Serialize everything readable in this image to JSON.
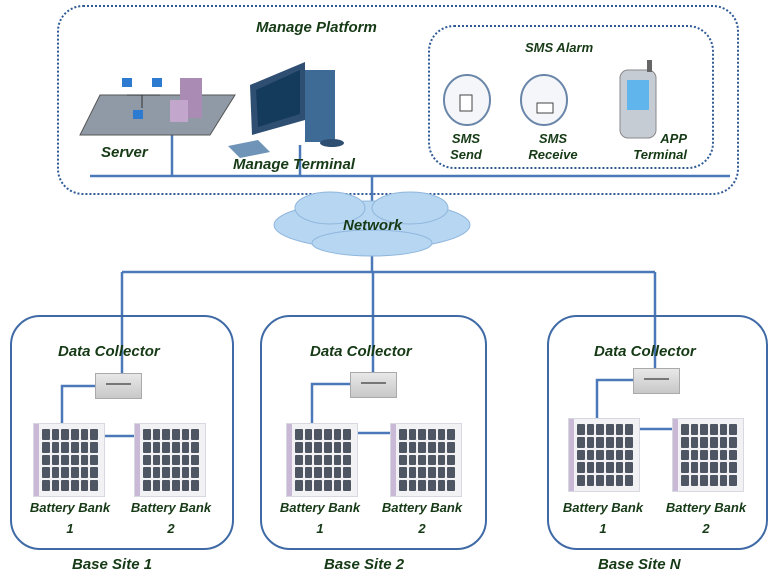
{
  "platform": {
    "title": "Manage Platform",
    "server": "Server",
    "terminal": "Manage Terminal"
  },
  "sms": {
    "title": "SMS Alarm",
    "send": [
      "SMS",
      "Send"
    ],
    "receive": [
      "SMS",
      "Receive"
    ],
    "app": [
      "APP",
      "Terminal"
    ]
  },
  "network": "Network",
  "sites": [
    {
      "name": "Base Site  1",
      "collector": "Data Collector",
      "banks": [
        {
          "label": "Battery Bank",
          "num": "1"
        },
        {
          "label": "Battery Bank",
          "num": "2"
        }
      ]
    },
    {
      "name": "Base Site  2",
      "collector": "Data Collector",
      "banks": [
        {
          "label": "Battery Bank",
          "num": "1"
        },
        {
          "label": "Battery Bank",
          "num": "2"
        }
      ]
    },
    {
      "name": "Base Site  N",
      "collector": "Data Collector",
      "banks": [
        {
          "label": "Battery Bank",
          "num": "1"
        },
        {
          "label": "Battery Bank",
          "num": "2"
        }
      ]
    }
  ],
  "colors": {
    "line": "#4a78b8",
    "text": "#163a16",
    "border": "#3f6aa6"
  }
}
